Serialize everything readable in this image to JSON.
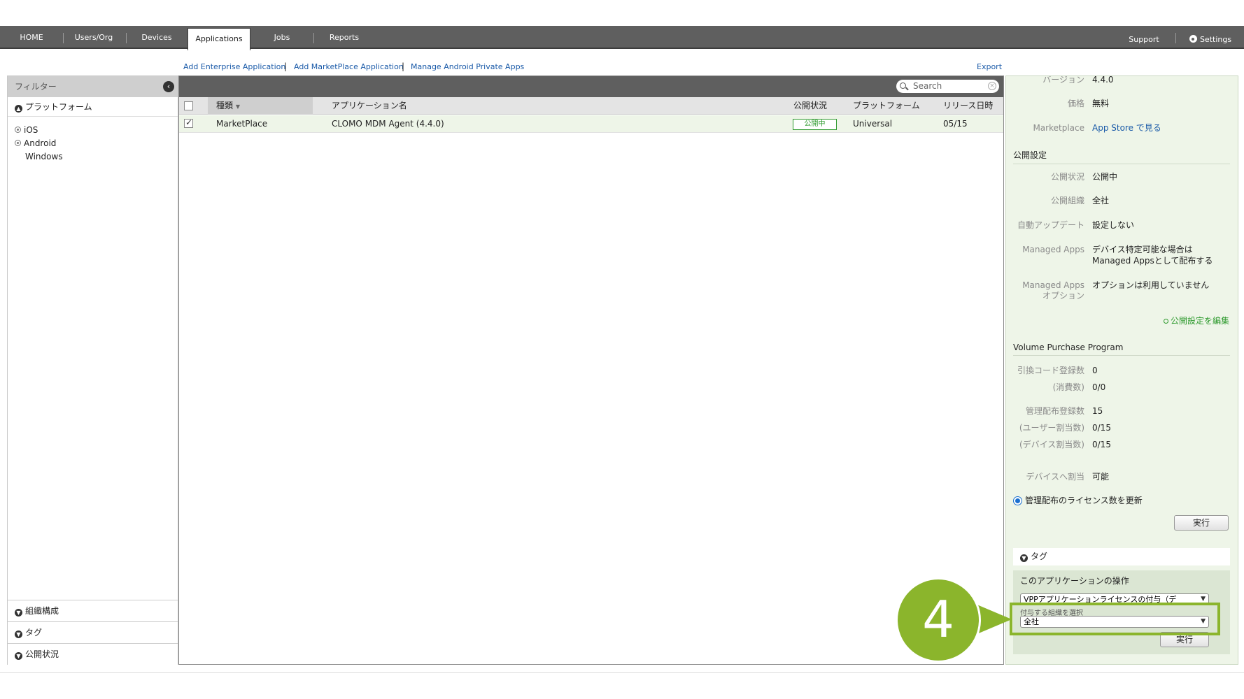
{
  "nav": {
    "items": [
      {
        "label": "HOME"
      },
      {
        "label": "Users/Org"
      },
      {
        "label": "Devices"
      },
      {
        "label": "Applications",
        "active": true
      },
      {
        "label": "Jobs"
      },
      {
        "label": "Reports"
      }
    ],
    "support_label": "Support",
    "settings_label": "Settings",
    "settings_icon": "gear-icon"
  },
  "actions": {
    "add_enterprise": "Add Enterprise Application",
    "add_marketplace": "Add MarketPlace Application",
    "manage_android": "Manage Android Private Apps",
    "separator": "|",
    "export": "Export"
  },
  "filter": {
    "title": "フィルター",
    "platform_section": "プラットフォーム",
    "platforms": [
      "iOS",
      "Android",
      "Windows"
    ],
    "bottom_sections": [
      "組織構成",
      "タグ",
      "公開状況"
    ]
  },
  "search": {
    "placeholder": "Search"
  },
  "table": {
    "columns": [
      "種類",
      "アプリケーション名",
      "公開状況",
      "プラットフォーム",
      "リリース日時"
    ],
    "rows": [
      {
        "type": "MarketPlace",
        "name": "CLOMO MDM Agent (4.4.0)",
        "status": "公開中",
        "platform": "Universal",
        "release": "05/15",
        "checked": true
      }
    ]
  },
  "detail": {
    "version_label": "バージョン",
    "version_value": "4.4.0",
    "price_label": "価格",
    "price_value": "無料",
    "marketplace_label": "Marketplace",
    "marketplace_value": "App Store で見る",
    "publish_heading": "公開設定",
    "publish_fields": [
      {
        "label": "公開状況",
        "value": "公開中"
      },
      {
        "label": "公開組織",
        "value": "全社"
      },
      {
        "label": "自動アップデート",
        "value": "設定しない"
      }
    ],
    "managed_label": "Managed Apps",
    "managed_value_1": "デバイス特定可能な場合は",
    "managed_value_2": "Managed Appsとして配布する",
    "managed_opt_label_1": "Managed Apps",
    "managed_opt_label_2": "オプション",
    "managed_opt_value": "オプションは利用していません",
    "edit_publish": "公開設定を編集",
    "vpp_heading": "Volume Purchase Program",
    "vpp_fields": [
      {
        "label": "引換コード登録数",
        "value": "0"
      },
      {
        "label": "(消費数)",
        "value": "0/0"
      },
      {
        "label": "管理配布登録数",
        "value": "15"
      },
      {
        "label": "(ユーザー割当数)",
        "value": "0/15"
      },
      {
        "label": "(デバイス割当数)",
        "value": "0/15"
      },
      {
        "label": "デバイスへ割当",
        "value": "可能"
      }
    ],
    "license_update_label": "管理配布のライセンス数を更新",
    "run_button": "実行",
    "tag_section": "タグ",
    "ops_title": "このアプリケーションの操作",
    "ops_select": "VPPアプリケーションライセンスの付与（デ",
    "org_select_label": "付与する組織を選択",
    "org_select_value": "全社",
    "ops_run_button": "実行"
  },
  "callout": {
    "step": "4",
    "color": "#8bb52c"
  }
}
